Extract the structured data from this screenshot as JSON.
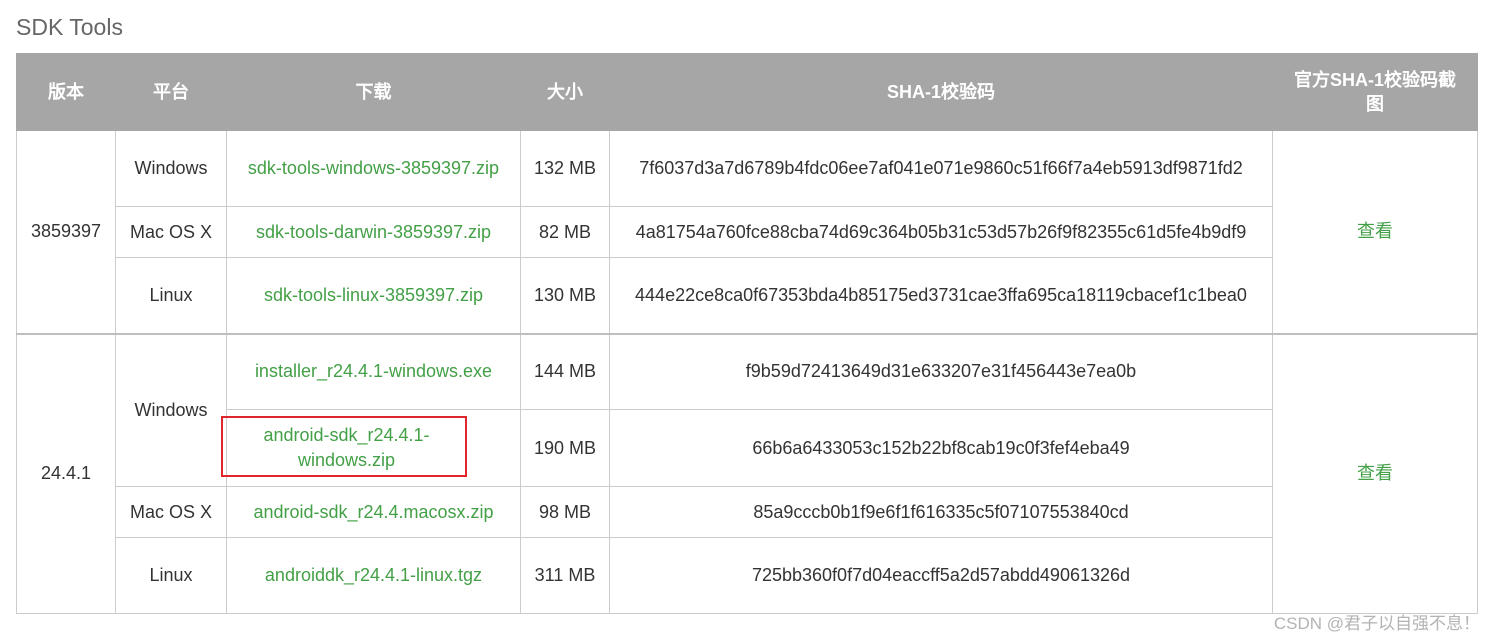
{
  "section_title": "SDK Tools",
  "columns": {
    "version": "版本",
    "platform": "平台",
    "download": "下载",
    "size": "大小",
    "sha1": "SHA-1校验码",
    "screenshot": "官方SHA-1校验码截图"
  },
  "groups": [
    {
      "version": "3859397",
      "view_label": "查看",
      "rows": [
        {
          "platform": "Windows",
          "file": "sdk-tools-windows-3859397.zip",
          "size": "132 MB",
          "sha1": "7f6037d3a7d6789b4fdc06ee7af041e071e9860c51f66f7a4eb5913df9871fd2"
        },
        {
          "platform": "Mac OS X",
          "file": "sdk-tools-darwin-3859397.zip",
          "size": "82 MB",
          "sha1": "4a81754a760fce88cba74d69c364b05b31c53d57b26f9f82355c61d5fe4b9df9"
        },
        {
          "platform": "Linux",
          "file": "sdk-tools-linux-3859397.zip",
          "size": "130 MB",
          "sha1": "444e22ce8ca0f67353bda4b85175ed3731cae3ffa695ca18119cbacef1c1bea0"
        }
      ]
    },
    {
      "version": "24.4.1",
      "view_label": "查看",
      "windows_platform": "Windows",
      "rows": [
        {
          "file": "installer_r24.4.1-windows.exe",
          "size": "144 MB",
          "sha1": "f9b59d72413649d31e633207e31f456443e7ea0b"
        },
        {
          "file": "android-sdk_r24.4.1-windows.zip",
          "size": "190 MB",
          "sha1": "66b6a6433053c152b22bf8cab19c0f3fef4eba49"
        },
        {
          "platform": "Mac OS X",
          "file": "android-sdk_r24.4.macosx.zip",
          "size": "98 MB",
          "sha1": "85a9cccb0b1f9e6f1f616335c5f07107553840cd"
        },
        {
          "platform": "Linux",
          "file": "androiddk_r24.4.1-linux.tgz",
          "size": "311 MB",
          "sha1": "725bb360f0f7d04eaccff5a2d57abdd49061326d"
        }
      ]
    }
  ],
  "highlighted_file": "android-sdk_r24.4.1-windows.zip",
  "watermark": "CSDN @君子以自强不息！",
  "colors": {
    "header_bg": "#a6a6a6",
    "link": "#43a047",
    "highlight_border": "#e0262b"
  }
}
